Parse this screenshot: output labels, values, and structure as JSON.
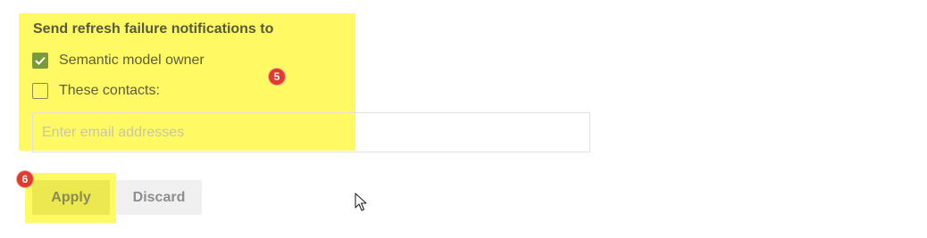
{
  "notifications": {
    "heading": "Send refresh failure notifications to",
    "options": [
      {
        "label": "Semantic model owner",
        "checked": true
      },
      {
        "label": "These contacts:",
        "checked": false
      }
    ],
    "email_placeholder": "Enter email addresses",
    "email_value": ""
  },
  "actions": {
    "apply_label": "Apply",
    "discard_label": "Discard"
  },
  "annotations": {
    "step_5": "5",
    "step_6": "6"
  },
  "colors": {
    "highlight": "#fff728",
    "badge": "#e23a2c",
    "checkbox_checked": "#7a9a3c"
  },
  "icons": {
    "check": "checkmark-icon",
    "cursor": "mouse-pointer-icon"
  }
}
